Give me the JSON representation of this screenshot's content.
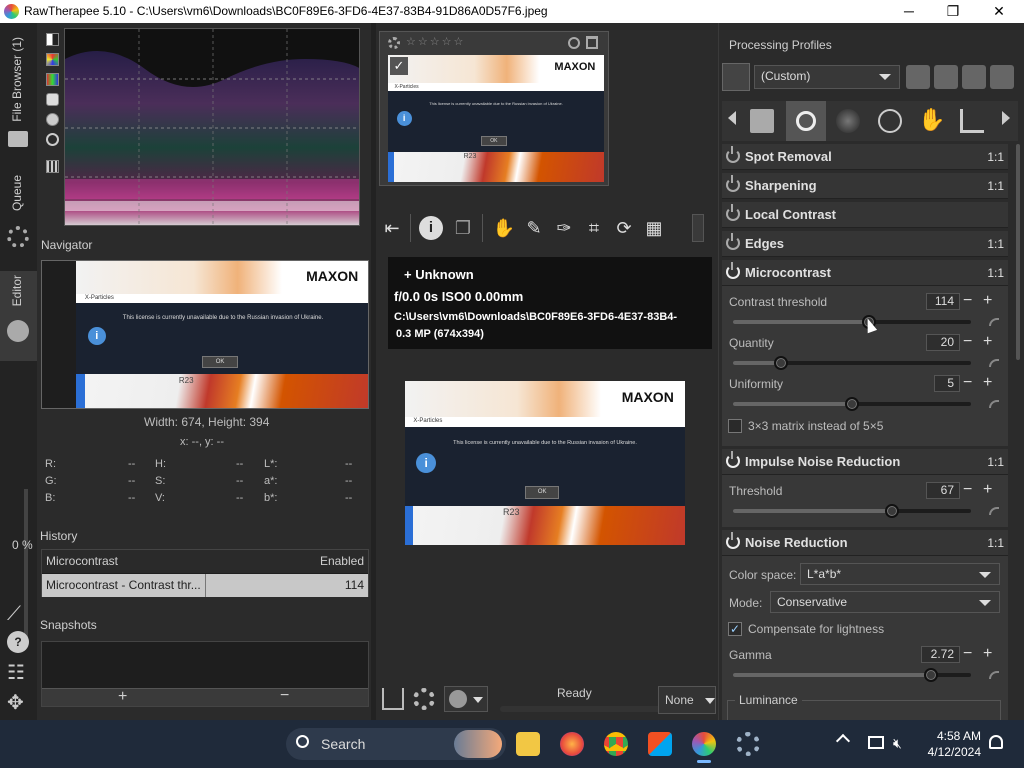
{
  "window": {
    "title": "RawTherapee 5.10 - C:\\Users\\vm6\\Downloads\\BC0F89E6-3FD6-4E37-83B4-91D86A0D57F6.jpeg",
    "minimize": "─",
    "maximize": "❐",
    "close": "✕"
  },
  "vtabs": {
    "file_browser": "File Browser (1)",
    "queue": "Queue",
    "editor": "Editor",
    "zoom_percent": "0 %"
  },
  "navigator": {
    "label": "Navigator",
    "dimensions": "Width: 674, Height: 394",
    "coords": "x: --, y: --",
    "rows": [
      {
        "a_label": "R:",
        "a_val": "--",
        "b_label": "H:",
        "b_val": "--",
        "c_label": "L*:",
        "c_val": "--"
      },
      {
        "a_label": "G:",
        "a_val": "--",
        "b_label": "S:",
        "b_val": "--",
        "c_label": "a*:",
        "c_val": "--"
      },
      {
        "a_label": "B:",
        "a_val": "--",
        "b_label": "V:",
        "b_val": "--",
        "c_label": "b*:",
        "c_val": "--"
      }
    ]
  },
  "image_content": {
    "brand": "MAXON",
    "window_label": "X-Particles",
    "message": "This license is currently unavailable due to the Russian invasion of Ukraine.",
    "ok_label": "OK",
    "release": "R23",
    "info_glyph": "i"
  },
  "history": {
    "label": "History",
    "items": [
      {
        "action": "Microcontrast",
        "value": "Enabled"
      },
      {
        "action": "Microcontrast - Contrast thr...",
        "value": "114"
      }
    ]
  },
  "snapshots": {
    "label": "Snapshots",
    "add": "+",
    "remove": "−"
  },
  "preview_info": {
    "camera": "+ Unknown",
    "exposure": "f/0.0  0s  ISO0  0.00mm",
    "path": "C:\\Users\\vm6\\Downloads\\BC0F89E6-3FD6-4E37-83B4-",
    "size": "0.3 MP (674x394)"
  },
  "center_status": {
    "ready": "Ready",
    "none_combo": "None"
  },
  "processing_profiles": {
    "label": "Processing Profiles",
    "selected": "(Custom)"
  },
  "tools": {
    "spot_removal": {
      "name": "Spot Removal",
      "scale": "1:1"
    },
    "sharpening": {
      "name": "Sharpening",
      "scale": "1:1"
    },
    "local_contrast": {
      "name": "Local Contrast",
      "scale": "1:1"
    },
    "edges": {
      "name": "Edges",
      "scale": "1:1"
    },
    "microcontrast": {
      "name": "Microcontrast",
      "scale": "1:1",
      "contrast_threshold": {
        "label": "Contrast threshold",
        "value": "114",
        "fraction": 0.57
      },
      "quantity": {
        "label": "Quantity",
        "value": "20",
        "fraction": 0.2
      },
      "uniformity": {
        "label": "Uniformity",
        "value": "5",
        "fraction": 0.5
      },
      "matrix_label": "3×3 matrix instead of 5×5"
    },
    "impulse_noise": {
      "name": "Impulse Noise Reduction",
      "scale": "1:1",
      "threshold": {
        "label": "Threshold",
        "value": "67",
        "fraction": 0.67
      }
    },
    "noise_reduction": {
      "name": "Noise Reduction",
      "scale": "1:1",
      "color_space_label": "Color space:",
      "color_space_value": "L*a*b*",
      "mode_label": "Mode:",
      "mode_value": "Conservative",
      "compensate_label": "Compensate for lightness",
      "gamma": {
        "label": "Gamma",
        "value": "2.72",
        "fraction": 0.83
      },
      "luminance_label": "Luminance"
    }
  },
  "taskbar": {
    "search_placeholder": "Search",
    "time": "4:58 AM",
    "date": "4/12/2024"
  }
}
